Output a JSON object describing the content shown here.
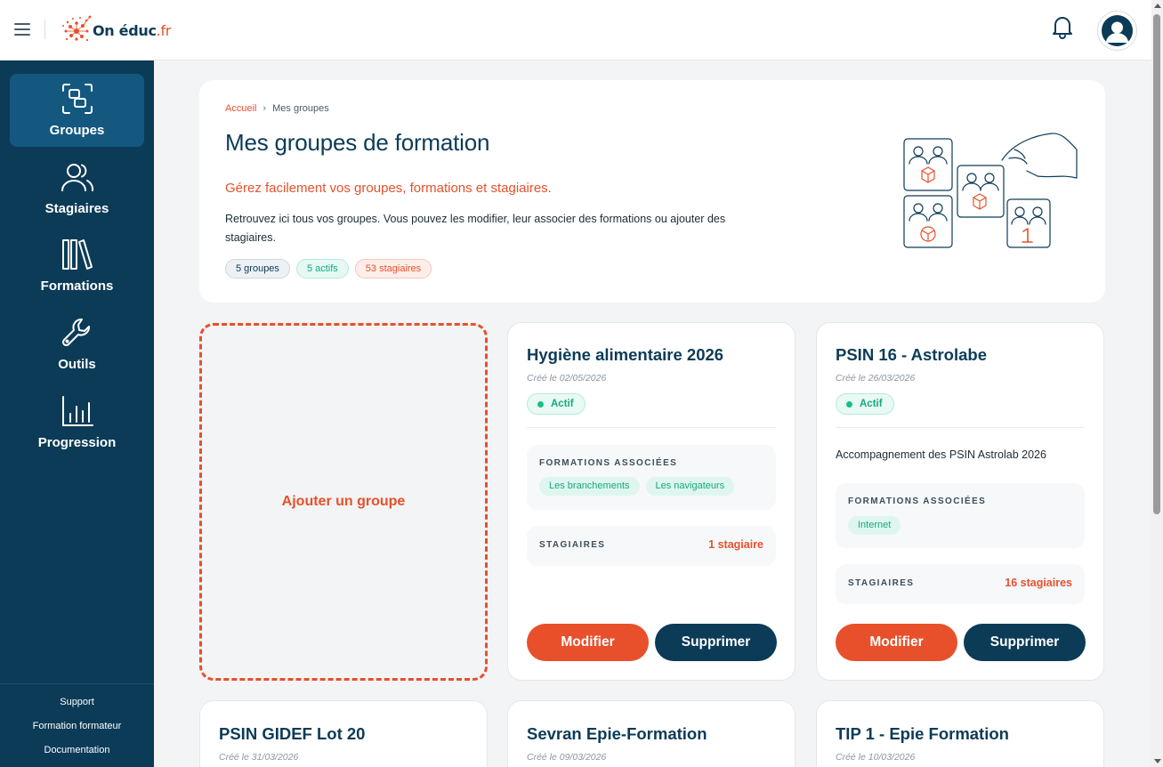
{
  "header": {
    "logo_text": "On éduc",
    "logo_tld": ".fr"
  },
  "sidebar": {
    "items": [
      {
        "label": "Groupes",
        "icon": "group-frame-icon",
        "active": true
      },
      {
        "label": "Stagiaires",
        "icon": "users-icon",
        "active": false
      },
      {
        "label": "Formations",
        "icon": "books-icon",
        "active": false
      },
      {
        "label": "Outils",
        "icon": "wrench-icon",
        "active": false
      },
      {
        "label": "Progression",
        "icon": "bar-chart-icon",
        "active": false
      }
    ],
    "footer_links": [
      "Support",
      "Formation formateur",
      "Documentation"
    ]
  },
  "hero": {
    "breadcrumb": {
      "home": "Accueil",
      "separator": "›",
      "current": "Mes groupes"
    },
    "title": "Mes groupes de formation",
    "subtitle": "Gérez facilement vos groupes, formations et stagiaires.",
    "description": "Retrouvez ici tous vos groupes. Vous pouvez les modifier, leur associer des formations ou ajouter des stagiaires.",
    "pills": {
      "groups": "5 groupes",
      "active": "5 actifs",
      "trainees": "53 stagiaires"
    }
  },
  "add_card": {
    "label": "Ajouter un groupe"
  },
  "labels": {
    "formations_section": "FORMATIONS ASSOCIÉES",
    "trainees_section": "STAGIAIRES",
    "edit_button": "Modifier",
    "delete_button": "Supprimer"
  },
  "groups": [
    {
      "title": "Hygiène alimentaire 2026",
      "created": "Créé le 02/05/2026",
      "status": "Actif",
      "description": "",
      "formations": [
        "Les branchements",
        "Les navigateurs"
      ],
      "trainees": "1 stagiaire"
    },
    {
      "title": "PSIN 16 - Astrolabe",
      "created": "Créé le 26/03/2026",
      "status": "Actif",
      "description": "Accompagnement des PSIN Astrolab 2026",
      "formations": [
        "Internet"
      ],
      "trainees": "16 stagiaires"
    },
    {
      "title": "PSIN GIDEF Lot 20",
      "created": "Créé le 31/03/2026"
    },
    {
      "title": "Sevran Epie-Formation",
      "created": "Créé le 09/03/2026"
    },
    {
      "title": "TIP 1 - Epie Formation",
      "created": "Créé le 10/03/2026"
    }
  ],
  "colors": {
    "navy": "#0c3b57",
    "accent": "#e8502b",
    "success": "#15a97e",
    "active_nav": "#14587f"
  }
}
